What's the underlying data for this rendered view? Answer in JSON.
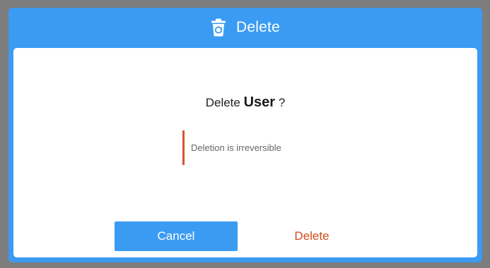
{
  "dialog": {
    "title": "Delete",
    "title_icon": "trash-icon",
    "question_prefix": "Delete",
    "entity_name": "User",
    "question_suffix": "?",
    "warning": "Deletion is irreversible",
    "cancel_label": "Cancel",
    "delete_label": "Delete"
  },
  "colors": {
    "accent": "#3b9bf3",
    "danger": "#d24a1a",
    "warning_bar": "#d9532b",
    "backdrop": "#7d7d7d"
  }
}
